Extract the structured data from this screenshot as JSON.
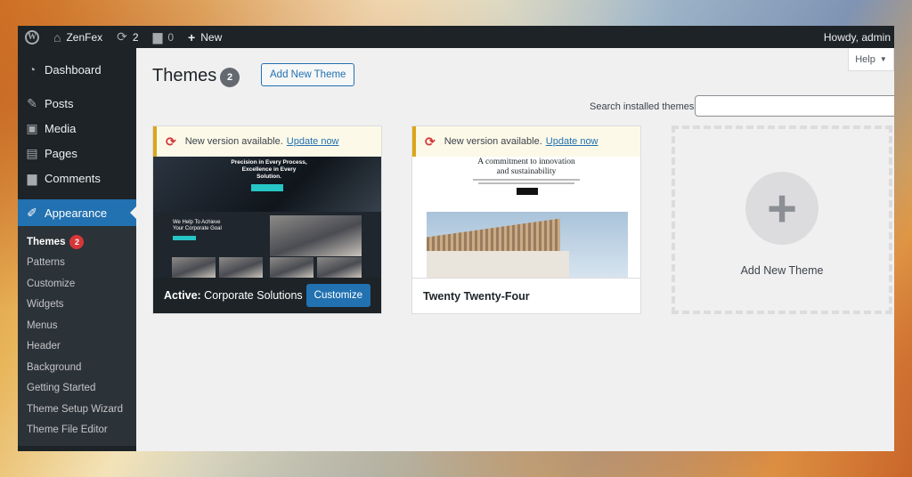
{
  "adminbar": {
    "site_name": "ZenFex",
    "updates_count": "2",
    "comments_count": "0",
    "new_label": "New",
    "howdy": "Howdy, admin"
  },
  "sidebar": {
    "items": [
      {
        "label": "Dashboard",
        "icon": "dashboard-icon"
      },
      {
        "label": "Posts",
        "icon": "pin-icon"
      },
      {
        "label": "Media",
        "icon": "media-icon"
      },
      {
        "label": "Pages",
        "icon": "pages-icon"
      },
      {
        "label": "Comments",
        "icon": "comment-icon"
      },
      {
        "label": "Appearance",
        "icon": "brush-icon"
      }
    ],
    "submenu": [
      {
        "label": "Themes",
        "badge": "2"
      },
      {
        "label": "Patterns"
      },
      {
        "label": "Customize"
      },
      {
        "label": "Widgets"
      },
      {
        "label": "Menus"
      },
      {
        "label": "Header"
      },
      {
        "label": "Background"
      },
      {
        "label": "Getting Started"
      },
      {
        "label": "Theme Setup Wizard"
      },
      {
        "label": "Theme File Editor"
      }
    ]
  },
  "main": {
    "help_label": "Help",
    "title": "Themes",
    "theme_count": "2",
    "add_new_theme_button": "Add New Theme",
    "search_label": "Search installed themes",
    "search_value": ""
  },
  "themes": [
    {
      "notice_text": "New version available.",
      "notice_link": "Update now",
      "active_prefix": "Active:",
      "name": "Corporate Solutions",
      "customize_label": "Customize",
      "preview": {
        "hero_line1": "Precision in Every Process,",
        "hero_line2": "Excellence in Every",
        "hero_line3": "Solution.",
        "goal_line1": "We Help To Achieve",
        "goal_line2": "Your Corporate Goal"
      }
    },
    {
      "notice_text": "New version available.",
      "notice_link": "Update now",
      "name": "Twenty Twenty-Four",
      "preview": {
        "heading_line1": "A commitment to innovation",
        "heading_line2": "and sustainability"
      }
    }
  ],
  "add_new_card": {
    "label": "Add New Theme"
  },
  "colors": {
    "admin_dark": "#1d2327",
    "accent_blue": "#2271b1",
    "badge_red": "#d63638",
    "notice_yellow": "#dba617"
  }
}
